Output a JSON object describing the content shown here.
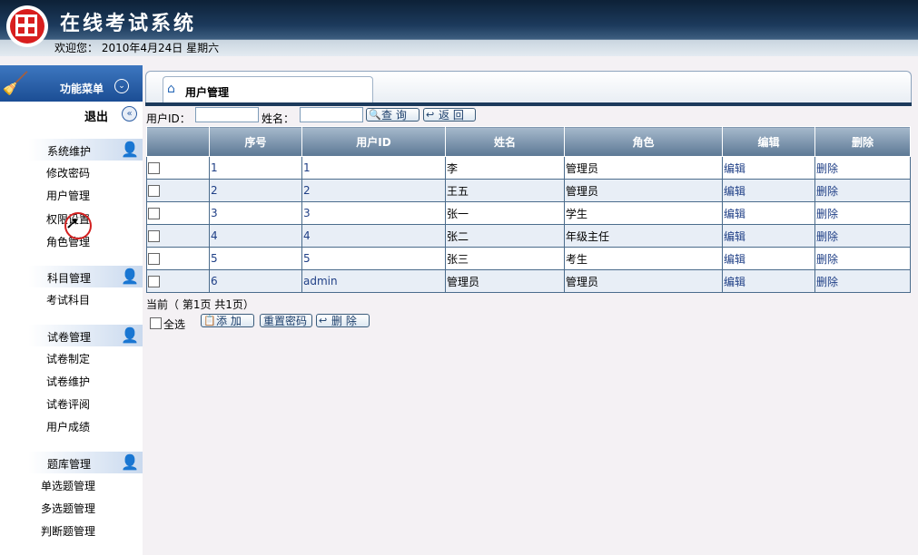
{
  "header": {
    "title": "在线考试系统",
    "welcome": "欢迎您： 2010年4月24日 星期六"
  },
  "sidebar": {
    "menu_title": "功能菜单",
    "logout": "退出",
    "sections": [
      {
        "title": "系统维护",
        "items": [
          "修改密码",
          "用户管理",
          "权限设置",
          "角色管理"
        ]
      },
      {
        "title": "科目管理",
        "items": [
          "考试科目"
        ]
      },
      {
        "title": "试卷管理",
        "items": [
          "试卷制定",
          "试卷维护",
          "试卷评阅",
          "用户成绩"
        ]
      },
      {
        "title": "题库管理",
        "items": [
          "单选题管理",
          "多选题管理",
          "判断题管理"
        ]
      }
    ]
  },
  "tab": {
    "label": "用户管理"
  },
  "filter": {
    "userid_label": "用户ID：",
    "userid_value": "",
    "name_label": "姓名：",
    "name_value": "",
    "search_button": "查 询",
    "back_button": "返 回"
  },
  "table": {
    "columns": [
      "",
      "序号",
      "用户ID",
      "姓名",
      "角色",
      "编辑",
      "删除"
    ],
    "rows": [
      {
        "no": "1",
        "userid": "1",
        "name": "李",
        "role": "管理员",
        "edit": "编辑",
        "delete": "删除"
      },
      {
        "no": "2",
        "userid": "2",
        "name": "王五",
        "role": "管理员",
        "edit": "编辑",
        "delete": "删除"
      },
      {
        "no": "3",
        "userid": "3",
        "name": "张一",
        "role": "学生",
        "edit": "编辑",
        "delete": "删除"
      },
      {
        "no": "4",
        "userid": "4",
        "name": "张二",
        "role": "年级主任",
        "edit": "编辑",
        "delete": "删除"
      },
      {
        "no": "5",
        "userid": "5",
        "name": "张三",
        "role": "考生",
        "edit": "编辑",
        "delete": "删除"
      },
      {
        "no": "6",
        "userid": "admin",
        "name": "管理员",
        "role": "管理员",
        "edit": "编辑",
        "delete": "删除"
      }
    ]
  },
  "pager": {
    "text": "当前（ 第1页 共1页）"
  },
  "bottom": {
    "select_all": "全选",
    "add_button": "添 加",
    "reset_button": "重置密码",
    "delete_button": "删 除"
  },
  "colors": {
    "header_dark": "#0d2137",
    "menu_blue": "#1b4d94",
    "grid_header": "#5c7894",
    "row_alt": "#e8eef6"
  }
}
